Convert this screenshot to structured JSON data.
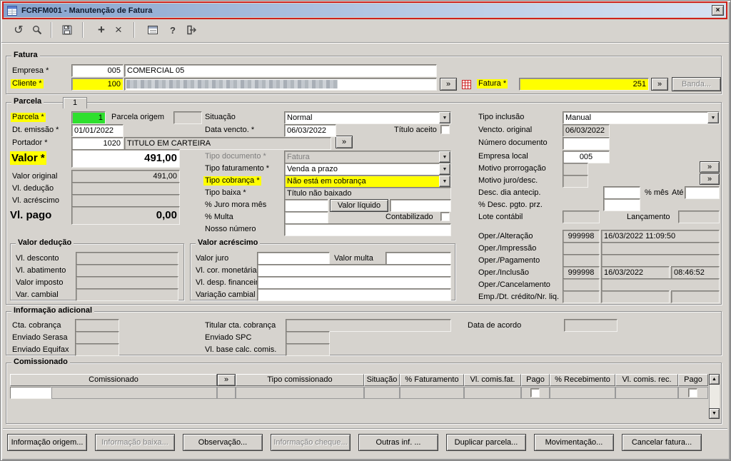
{
  "window": {
    "title": "FCRFM001 - Manutenção de Fatura"
  },
  "glyphs": {
    "close": "×",
    "undo": "↺",
    "plus": "+",
    "delete": "×",
    "help": "?",
    "lookup": "»",
    "combo_arrow": "▼",
    "scroll_up": "▲",
    "scroll_down": "▼"
  },
  "colors": {
    "highlight_yellow": "#ffff00",
    "highlight_green": "#2ee02e",
    "annotation_red": "#cd221b",
    "window_face": "#d6d3ce"
  },
  "fatura": {
    "legend": "Fatura",
    "empresa_label": "Empresa *",
    "empresa_code": "005",
    "empresa_name": "COMERCIAL 05",
    "cliente_label": "Cliente *",
    "cliente_code": "100",
    "fatura_label": "Fatura *",
    "fatura_value": "251",
    "banda_button": "Banda..."
  },
  "parcela": {
    "legend": "Parcela",
    "tab": "1",
    "parcela_label": "Parcela *",
    "parcela_value": "1",
    "parcela_origem_label": "Parcela origem",
    "parcela_origem_value": "",
    "dt_emissao_label": "Dt. emissão *",
    "dt_emissao_value": "01/01/2022",
    "portador_label": "Portador *",
    "portador_code": "1020",
    "portador_name": "TITULO EM CARTEIRA",
    "valor_label": "Valor *",
    "valor_value": "491,00",
    "valor_original_label": "Valor original",
    "valor_original_value": "491,00",
    "vl_deducao_label": "Vl. dedução",
    "vl_deducao_value": "",
    "vl_acrescimo_label": "Vl. acréscimo",
    "vl_acrescimo_value": "",
    "vl_pago_label": "Vl. pago",
    "vl_pago_value": "0,00",
    "situacao_label": "Situação",
    "situacao_value": "Normal",
    "data_vencto_label": "Data vencto. *",
    "data_vencto_value": "06/03/2022",
    "titulo_aceito_label": "Título aceito",
    "tipo_documento_label": "Tipo documento *",
    "tipo_documento_value": "Fatura",
    "tipo_faturamento_label": "Tipo faturamento *",
    "tipo_faturamento_value": "Venda a prazo",
    "tipo_cobranca_label": "Tipo cobrança *",
    "tipo_cobranca_value": "Não está em cobrança",
    "tipo_baixa_label": "Tipo baixa *",
    "tipo_baixa_value": "Título não baixado",
    "juro_mora_label": "% Juro mora mês",
    "juro_mora_value": "",
    "valor_liquido_label": "Valor líquido",
    "valor_liquido_value": "",
    "multa_label": "% Multa",
    "multa_value": "",
    "contabilizado_label": "Contabilizado",
    "nosso_numero_label": "Nosso número",
    "nosso_numero_value": "",
    "tipo_inclusao_label": "Tipo inclusão",
    "tipo_inclusao_value": "Manual",
    "vencto_original_label": "Vencto. original",
    "vencto_original_value": "06/03/2022",
    "numero_documento_label": "Número documento",
    "numero_documento_value": "",
    "empresa_local_label": "Empresa local",
    "empresa_local_value": "005",
    "motivo_prorrogacao_label": "Motivo prorrogação",
    "motivo_prorrogacao_value": "",
    "motivo_juro_desc_label": "Motivo juro/desc.",
    "motivo_juro_desc_value": "",
    "desc_dia_antecip_label": "Desc. dia antecip.",
    "desc_dia_antecip_value": "",
    "pct_mes_label": "% mês",
    "ate_label": "Até",
    "ate_value": "",
    "desc_pgto_prz_label": "% Desc. pgto. prz.",
    "desc_pgto_prz_value": "",
    "lote_contabil_label": "Lote contábil",
    "lote_contabil_value": "",
    "lancamento_label": "Lançamento",
    "lancamento_value": "",
    "oper_alteracao_label": "Oper./Alteração",
    "oper_alteracao_code": "999998",
    "oper_alteracao_datetime": "16/03/2022 11:09:50",
    "oper_impressao_label": "Oper./Impressão",
    "oper_impressao_code": "",
    "oper_impressao_datetime": "",
    "oper_pagamento_label": "Oper./Pagamento",
    "oper_pagamento_code": "",
    "oper_pagamento_datetime": "",
    "oper_inclusao_label": "Oper./Inclusão",
    "oper_inclusao_code": "999998",
    "oper_inclusao_date": "16/03/2022",
    "oper_inclusao_time": "08:46:52",
    "oper_cancelamento_label": "Oper./Cancelamento",
    "oper_cancelamento_code": "",
    "oper_cancelamento_datetime": "",
    "emp_dt_credito_label": "Emp./Dt. crédito/Nr. liq.",
    "emp_dt_credito_code": "",
    "emp_dt_credito_date": "",
    "emp_dt_credito_num": ""
  },
  "valor_deducao": {
    "legend": "Valor dedução",
    "vl_desconto_label": "Vl. desconto",
    "vl_desconto_value": "",
    "vl_abatimento_label": "Vl. abatimento",
    "vl_abatimento_value": "",
    "valor_imposto_label": "Valor imposto",
    "valor_imposto_value": "",
    "var_cambial_label": "Var. cambial",
    "var_cambial_value": ""
  },
  "valor_acrescimo": {
    "legend": "Valor acréscimo",
    "valor_juro_label": "Valor juro",
    "valor_juro_value": "",
    "valor_multa_label": "Valor multa",
    "valor_multa_value": "",
    "vl_cor_monetaria_label": "Vl. cor. monetária",
    "vl_cor_monetaria_value": "",
    "vl_desp_financeira_label": "Vl. desp. financeira",
    "vl_desp_financeira_value": "",
    "variacao_cambial_label": "Variação cambial",
    "variacao_cambial_value": ""
  },
  "info_adicional": {
    "legend": "Informação adicional",
    "cta_cobranca_label": "Cta. cobrança",
    "enviado_serasa_label": "Enviado Serasa",
    "enviado_equifax_label": "Enviado Equifax",
    "titular_cta_label": "Titular cta. cobrança",
    "enviado_spc_label": "Enviado SPC",
    "vl_base_calc_label": "Vl. base calc. comis.",
    "data_acordo_label": "Data de acordo"
  },
  "comissionado": {
    "legend": "Comissionado",
    "headers": [
      "Comissionado",
      "»",
      "Tipo comissionado",
      "Situação",
      "% Faturamento",
      "Vl. comis.fat.",
      "Pago",
      "% Recebimento",
      "Vl. comis. rec.",
      "Pago"
    ]
  },
  "buttons": [
    {
      "label": "Informação origem...",
      "enabled": true
    },
    {
      "label": "Informação baixa...",
      "enabled": false
    },
    {
      "label": "Observação...",
      "enabled": true
    },
    {
      "label": "Informação cheque...",
      "enabled": false
    },
    {
      "label": "Outras inf. ...",
      "enabled": true
    },
    {
      "label": "Duplicar parcela...",
      "enabled": true
    },
    {
      "label": "Movimentação...",
      "enabled": true
    },
    {
      "label": "Cancelar fatura...",
      "enabled": true
    }
  ]
}
